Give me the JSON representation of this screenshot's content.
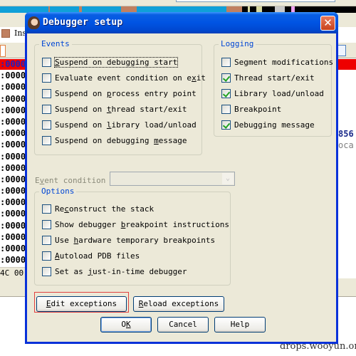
{
  "background": {
    "legend_text": "Ins",
    "code_rows": [
      ":0000",
      ":0000",
      ":0000",
      ":0000",
      ":0000",
      ":0000",
      ":0000",
      ":0000",
      ":0000",
      ":0000",
      ":0000",
      ":0000",
      ":0000",
      ":0000",
      ":0000",
      ":0000",
      ":0000",
      ":0000"
    ],
    "hex_row": "4C 00",
    "right_number": "856",
    "right_text": "oca",
    "colors": {
      "nav_band": "#10a0d8",
      "current_line": "#ee0000"
    }
  },
  "dialog": {
    "title": "Debugger setup",
    "title_icon": "app-icon",
    "close_icon": "close-icon",
    "close_glyph": "✕",
    "events": {
      "legend": "Events",
      "items": [
        {
          "label_pre": "",
          "label_key": "S",
          "label_post": "uspend on debugging start",
          "checked": false,
          "focused": true
        },
        {
          "label_pre": "Evaluate event condition on e",
          "label_key": "x",
          "label_post": "it",
          "checked": false
        },
        {
          "label_pre": "Suspend on ",
          "label_key": "p",
          "label_post": "rocess entry point",
          "checked": false
        },
        {
          "label_pre": "Suspend on ",
          "label_key": "t",
          "label_post": "hread start/exit",
          "checked": false
        },
        {
          "label_pre": "Suspend on ",
          "label_key": "l",
          "label_post": "ibrary load/unload",
          "checked": false
        },
        {
          "label_pre": "Suspend on debugging ",
          "label_key": "m",
          "label_post": "essage",
          "checked": false
        }
      ]
    },
    "logging": {
      "legend": "Logging",
      "items": [
        {
          "label": "Segment modifications",
          "checked": false
        },
        {
          "label": "Thread start/exit",
          "checked": true
        },
        {
          "label": "Library load/unload",
          "checked": true
        },
        {
          "label": "Breakpoint",
          "checked": false
        },
        {
          "label": "Debugging message",
          "checked": true
        }
      ]
    },
    "event_condition": {
      "label_pre": "E",
      "label_key": "v",
      "label_post": "ent condition",
      "value": "",
      "disabled": true,
      "arrow_glyph": "⌄"
    },
    "options": {
      "legend": "Options",
      "items": [
        {
          "label_pre": "Re",
          "label_key": "c",
          "label_post": "onstruct the stack",
          "checked": false
        },
        {
          "label_pre": "Show debugger ",
          "label_key": "b",
          "label_post": "reakpoint instructions",
          "checked": false
        },
        {
          "label_pre": "Use ",
          "label_key": "h",
          "label_post": "ardware temporary breakpoints",
          "checked": false
        },
        {
          "label_pre": "",
          "label_key": "A",
          "label_post": "utoload PDB files",
          "checked": false
        },
        {
          "label_pre": "Set as ",
          "label_key": "j",
          "label_post": "ust-in-time debugger",
          "checked": false
        }
      ]
    },
    "buttons": {
      "edit_exceptions": {
        "key": "E",
        "rest": "dit exceptions"
      },
      "reload_exceptions": {
        "key": "R",
        "rest": "eload exceptions"
      },
      "ok": {
        "pre": "O",
        "key": "K",
        "rest": ""
      },
      "cancel": {
        "label": "Cancel"
      },
      "help": {
        "label": "Help"
      }
    },
    "highlight_color": "#e04040"
  },
  "watermark": "drops.wooyun.org"
}
